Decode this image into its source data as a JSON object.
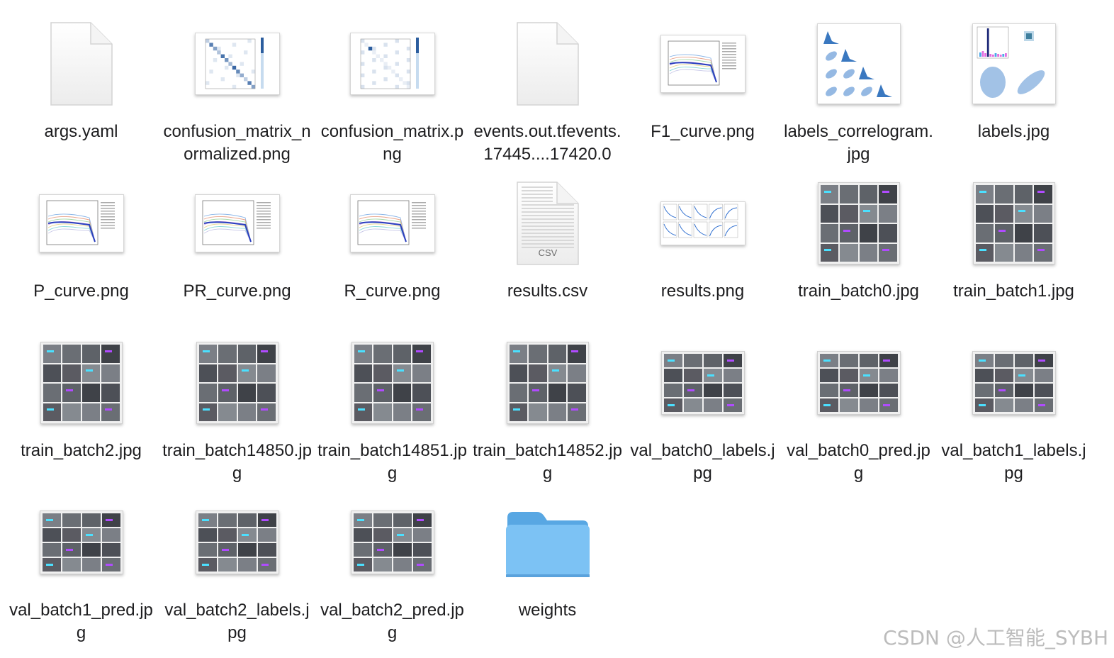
{
  "files": [
    {
      "name": "args.yaml",
      "kind": "doc",
      "icon": "document-icon"
    },
    {
      "name": "confusion_matrix_normalized.png",
      "kind": "matrix",
      "icon": "confusion-matrix-thumbnail-icon"
    },
    {
      "name": "confusion_matrix.png",
      "kind": "matrix2",
      "icon": "confusion-matrix-thumbnail-icon"
    },
    {
      "name": "events.out.tfevents.17445....17420.0",
      "kind": "doc",
      "icon": "document-icon"
    },
    {
      "name": "F1_curve.png",
      "kind": "curve",
      "icon": "curve-chart-thumbnail-icon"
    },
    {
      "name": "labels_correlogram.jpg",
      "kind": "correlogram",
      "icon": "correlogram-thumbnail-icon"
    },
    {
      "name": "labels.jpg",
      "kind": "labels",
      "icon": "labels-chart-thumbnail-icon"
    },
    {
      "name": "P_curve.png",
      "kind": "curve",
      "icon": "curve-chart-thumbnail-icon"
    },
    {
      "name": "PR_curve.png",
      "kind": "curve",
      "icon": "curve-chart-thumbnail-icon"
    },
    {
      "name": "R_curve.png",
      "kind": "curve",
      "icon": "curve-chart-thumbnail-icon"
    },
    {
      "name": "results.csv",
      "kind": "csv",
      "icon": "csv-document-icon",
      "badge": "CSV"
    },
    {
      "name": "results.png",
      "kind": "results",
      "icon": "results-chart-thumbnail-icon"
    },
    {
      "name": "train_batch0.jpg",
      "kind": "photo",
      "icon": "image-mosaic-thumbnail-icon"
    },
    {
      "name": "train_batch1.jpg",
      "kind": "photo",
      "icon": "image-mosaic-thumbnail-icon"
    },
    {
      "name": "train_batch2.jpg",
      "kind": "photo",
      "icon": "image-mosaic-thumbnail-icon"
    },
    {
      "name": "train_batch14850.jpg",
      "kind": "photo",
      "icon": "image-mosaic-thumbnail-icon"
    },
    {
      "name": "train_batch14851.jpg",
      "kind": "photo",
      "icon": "image-mosaic-thumbnail-icon"
    },
    {
      "name": "train_batch14852.jpg",
      "kind": "photo",
      "icon": "image-mosaic-thumbnail-icon"
    },
    {
      "name": "val_batch0_labels.jpg",
      "kind": "val",
      "icon": "image-mosaic-thumbnail-icon"
    },
    {
      "name": "val_batch0_pred.jpg",
      "kind": "val",
      "icon": "image-mosaic-thumbnail-icon"
    },
    {
      "name": "val_batch1_labels.jpg",
      "kind": "val",
      "icon": "image-mosaic-thumbnail-icon"
    },
    {
      "name": "val_batch1_pred.jpg",
      "kind": "val",
      "icon": "image-mosaic-thumbnail-icon"
    },
    {
      "name": "val_batch2_labels.jpg",
      "kind": "val",
      "icon": "image-mosaic-thumbnail-icon"
    },
    {
      "name": "val_batch2_pred.jpg",
      "kind": "val",
      "icon": "image-mosaic-thumbnail-icon"
    },
    {
      "name": "weights",
      "kind": "folder",
      "icon": "folder-icon"
    }
  ],
  "colors": {
    "folder_front": "#7cc2f4",
    "folder_back": "#58a7e3",
    "matrix": "#2b5d9e",
    "photo_tile": "#58585e"
  },
  "watermark": "CSDN @人工智能_SYBH"
}
